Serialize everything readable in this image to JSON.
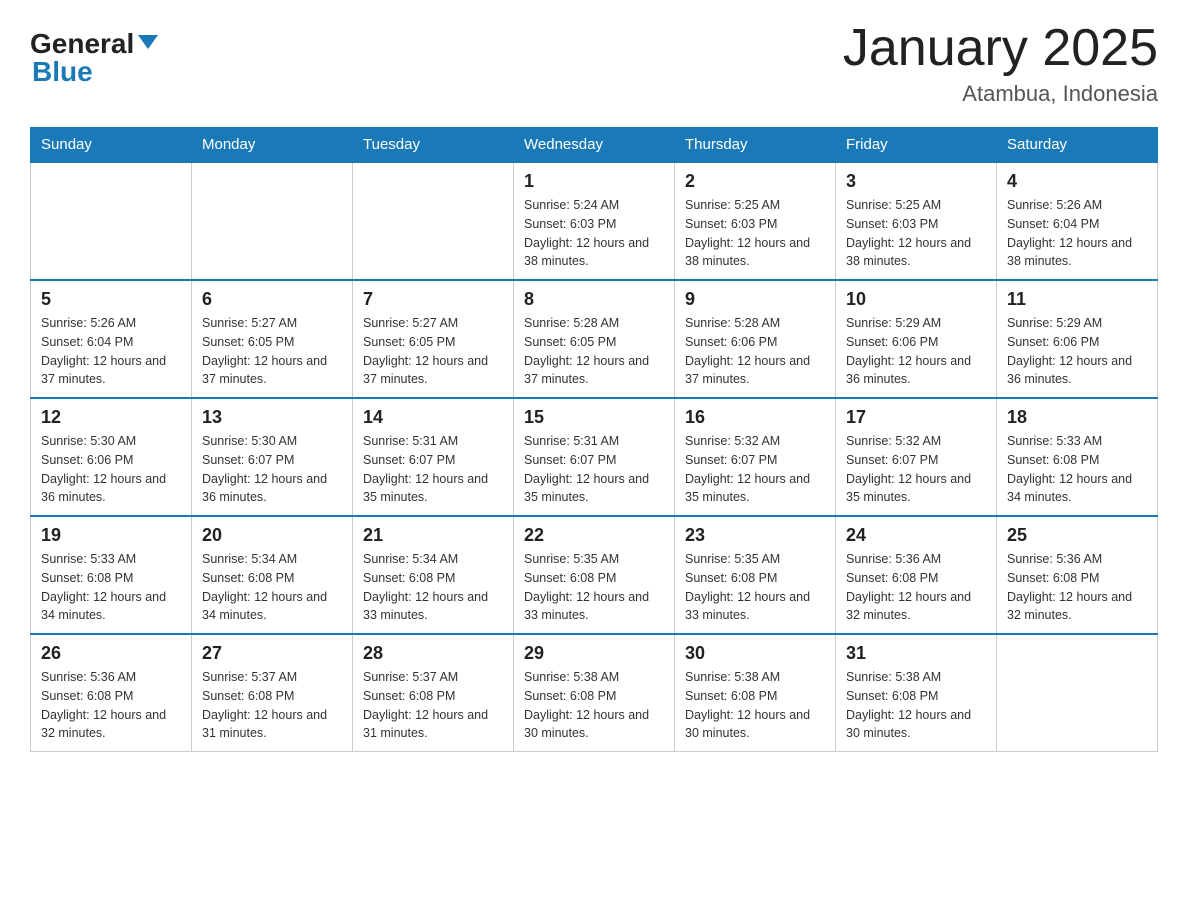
{
  "header": {
    "logo_general": "General",
    "logo_blue": "Blue",
    "month_title": "January 2025",
    "location": "Atambua, Indonesia"
  },
  "days_of_week": [
    "Sunday",
    "Monday",
    "Tuesday",
    "Wednesday",
    "Thursday",
    "Friday",
    "Saturday"
  ],
  "weeks": [
    [
      {
        "day": "",
        "sunrise": "",
        "sunset": "",
        "daylight": ""
      },
      {
        "day": "",
        "sunrise": "",
        "sunset": "",
        "daylight": ""
      },
      {
        "day": "",
        "sunrise": "",
        "sunset": "",
        "daylight": ""
      },
      {
        "day": "1",
        "sunrise": "Sunrise: 5:24 AM",
        "sunset": "Sunset: 6:03 PM",
        "daylight": "Daylight: 12 hours and 38 minutes."
      },
      {
        "day": "2",
        "sunrise": "Sunrise: 5:25 AM",
        "sunset": "Sunset: 6:03 PM",
        "daylight": "Daylight: 12 hours and 38 minutes."
      },
      {
        "day": "3",
        "sunrise": "Sunrise: 5:25 AM",
        "sunset": "Sunset: 6:03 PM",
        "daylight": "Daylight: 12 hours and 38 minutes."
      },
      {
        "day": "4",
        "sunrise": "Sunrise: 5:26 AM",
        "sunset": "Sunset: 6:04 PM",
        "daylight": "Daylight: 12 hours and 38 minutes."
      }
    ],
    [
      {
        "day": "5",
        "sunrise": "Sunrise: 5:26 AM",
        "sunset": "Sunset: 6:04 PM",
        "daylight": "Daylight: 12 hours and 37 minutes."
      },
      {
        "day": "6",
        "sunrise": "Sunrise: 5:27 AM",
        "sunset": "Sunset: 6:05 PM",
        "daylight": "Daylight: 12 hours and 37 minutes."
      },
      {
        "day": "7",
        "sunrise": "Sunrise: 5:27 AM",
        "sunset": "Sunset: 6:05 PM",
        "daylight": "Daylight: 12 hours and 37 minutes."
      },
      {
        "day": "8",
        "sunrise": "Sunrise: 5:28 AM",
        "sunset": "Sunset: 6:05 PM",
        "daylight": "Daylight: 12 hours and 37 minutes."
      },
      {
        "day": "9",
        "sunrise": "Sunrise: 5:28 AM",
        "sunset": "Sunset: 6:06 PM",
        "daylight": "Daylight: 12 hours and 37 minutes."
      },
      {
        "day": "10",
        "sunrise": "Sunrise: 5:29 AM",
        "sunset": "Sunset: 6:06 PM",
        "daylight": "Daylight: 12 hours and 36 minutes."
      },
      {
        "day": "11",
        "sunrise": "Sunrise: 5:29 AM",
        "sunset": "Sunset: 6:06 PM",
        "daylight": "Daylight: 12 hours and 36 minutes."
      }
    ],
    [
      {
        "day": "12",
        "sunrise": "Sunrise: 5:30 AM",
        "sunset": "Sunset: 6:06 PM",
        "daylight": "Daylight: 12 hours and 36 minutes."
      },
      {
        "day": "13",
        "sunrise": "Sunrise: 5:30 AM",
        "sunset": "Sunset: 6:07 PM",
        "daylight": "Daylight: 12 hours and 36 minutes."
      },
      {
        "day": "14",
        "sunrise": "Sunrise: 5:31 AM",
        "sunset": "Sunset: 6:07 PM",
        "daylight": "Daylight: 12 hours and 35 minutes."
      },
      {
        "day": "15",
        "sunrise": "Sunrise: 5:31 AM",
        "sunset": "Sunset: 6:07 PM",
        "daylight": "Daylight: 12 hours and 35 minutes."
      },
      {
        "day": "16",
        "sunrise": "Sunrise: 5:32 AM",
        "sunset": "Sunset: 6:07 PM",
        "daylight": "Daylight: 12 hours and 35 minutes."
      },
      {
        "day": "17",
        "sunrise": "Sunrise: 5:32 AM",
        "sunset": "Sunset: 6:07 PM",
        "daylight": "Daylight: 12 hours and 35 minutes."
      },
      {
        "day": "18",
        "sunrise": "Sunrise: 5:33 AM",
        "sunset": "Sunset: 6:08 PM",
        "daylight": "Daylight: 12 hours and 34 minutes."
      }
    ],
    [
      {
        "day": "19",
        "sunrise": "Sunrise: 5:33 AM",
        "sunset": "Sunset: 6:08 PM",
        "daylight": "Daylight: 12 hours and 34 minutes."
      },
      {
        "day": "20",
        "sunrise": "Sunrise: 5:34 AM",
        "sunset": "Sunset: 6:08 PM",
        "daylight": "Daylight: 12 hours and 34 minutes."
      },
      {
        "day": "21",
        "sunrise": "Sunrise: 5:34 AM",
        "sunset": "Sunset: 6:08 PM",
        "daylight": "Daylight: 12 hours and 33 minutes."
      },
      {
        "day": "22",
        "sunrise": "Sunrise: 5:35 AM",
        "sunset": "Sunset: 6:08 PM",
        "daylight": "Daylight: 12 hours and 33 minutes."
      },
      {
        "day": "23",
        "sunrise": "Sunrise: 5:35 AM",
        "sunset": "Sunset: 6:08 PM",
        "daylight": "Daylight: 12 hours and 33 minutes."
      },
      {
        "day": "24",
        "sunrise": "Sunrise: 5:36 AM",
        "sunset": "Sunset: 6:08 PM",
        "daylight": "Daylight: 12 hours and 32 minutes."
      },
      {
        "day": "25",
        "sunrise": "Sunrise: 5:36 AM",
        "sunset": "Sunset: 6:08 PM",
        "daylight": "Daylight: 12 hours and 32 minutes."
      }
    ],
    [
      {
        "day": "26",
        "sunrise": "Sunrise: 5:36 AM",
        "sunset": "Sunset: 6:08 PM",
        "daylight": "Daylight: 12 hours and 32 minutes."
      },
      {
        "day": "27",
        "sunrise": "Sunrise: 5:37 AM",
        "sunset": "Sunset: 6:08 PM",
        "daylight": "Daylight: 12 hours and 31 minutes."
      },
      {
        "day": "28",
        "sunrise": "Sunrise: 5:37 AM",
        "sunset": "Sunset: 6:08 PM",
        "daylight": "Daylight: 12 hours and 31 minutes."
      },
      {
        "day": "29",
        "sunrise": "Sunrise: 5:38 AM",
        "sunset": "Sunset: 6:08 PM",
        "daylight": "Daylight: 12 hours and 30 minutes."
      },
      {
        "day": "30",
        "sunrise": "Sunrise: 5:38 AM",
        "sunset": "Sunset: 6:08 PM",
        "daylight": "Daylight: 12 hours and 30 minutes."
      },
      {
        "day": "31",
        "sunrise": "Sunrise: 5:38 AM",
        "sunset": "Sunset: 6:08 PM",
        "daylight": "Daylight: 12 hours and 30 minutes."
      },
      {
        "day": "",
        "sunrise": "",
        "sunset": "",
        "daylight": ""
      }
    ]
  ]
}
